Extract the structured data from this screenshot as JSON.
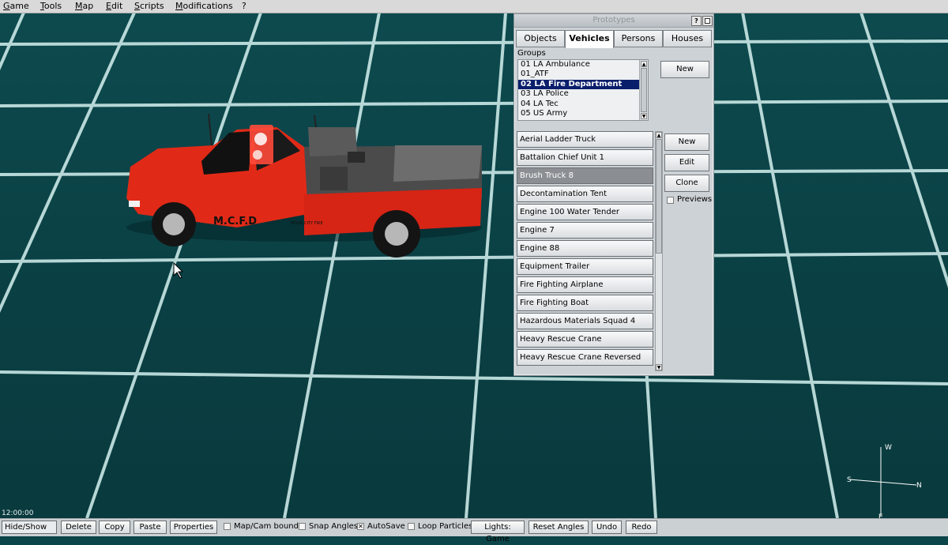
{
  "menubar": {
    "items": [
      {
        "key": "game",
        "label": "Game"
      },
      {
        "key": "tools",
        "label": "Tools"
      },
      {
        "key": "map",
        "label": "Map"
      },
      {
        "key": "edit",
        "label": "Edit"
      },
      {
        "key": "scripts",
        "label": "Scripts"
      },
      {
        "key": "modifications",
        "label": "Modifications"
      },
      {
        "key": "help",
        "label": "?"
      }
    ]
  },
  "vehicle": {
    "body_text": "M.C.F.D",
    "side_text": "MODA CITY FIRE",
    "body_color": "#e02a17"
  },
  "prototypes": {
    "title": "Prototypes",
    "help_button": "?",
    "tabs": [
      {
        "label": "Objects",
        "active": false
      },
      {
        "label": "Vehicles",
        "active": true
      },
      {
        "label": "Persons",
        "active": false
      },
      {
        "label": "Houses",
        "active": false
      }
    ],
    "groups_label": "Groups",
    "groups": [
      "01 LA Ambulance",
      "01_ATF",
      "02 LA Fire Department",
      "03 LA Police",
      "04 LA Tec",
      "05 US Army"
    ],
    "selected_group": 2,
    "group_new_button": "New",
    "vehicles": [
      "Aerial Ladder Truck",
      "Battalion Chief Unit 1",
      "Brush Truck 8",
      "Decontamination Tent",
      "Engine 100 Water Tender",
      "Engine 7",
      "Engine 88",
      "Equipment Trailer",
      "Fire Fighting Airplane",
      "Fire Fighting Boat",
      "Hazardous Materials Squad 4",
      "Heavy Rescue Crane",
      "Heavy Rescue Crane Reversed"
    ],
    "selected_vehicle": 2,
    "buttons": {
      "new": "New",
      "edit": "Edit",
      "clone": "Clone"
    },
    "previews_label": "Previews"
  },
  "status": {
    "time": "12:00:00"
  },
  "toolbar": {
    "hide_show": "Hide/Show",
    "delete": "Delete",
    "copy": "Copy",
    "paste": "Paste",
    "properties": "Properties",
    "map_cam_bounds": "Map/Cam bounds",
    "snap_angles": "Snap Angles",
    "autosave": "AutoSave",
    "loop_particles": "Loop Particles",
    "lights_game": "Lights: Game",
    "reset_angles": "Reset Angles",
    "undo": "Undo",
    "redo": "Redo",
    "autosave_checked": true
  },
  "compass": {
    "w": "W",
    "s": "S",
    "n": "N",
    "e": "E"
  },
  "colors": {
    "grid_bg": "#0c4549",
    "grid_line": "#d5f2f0",
    "selection": "#0a1f6b"
  }
}
